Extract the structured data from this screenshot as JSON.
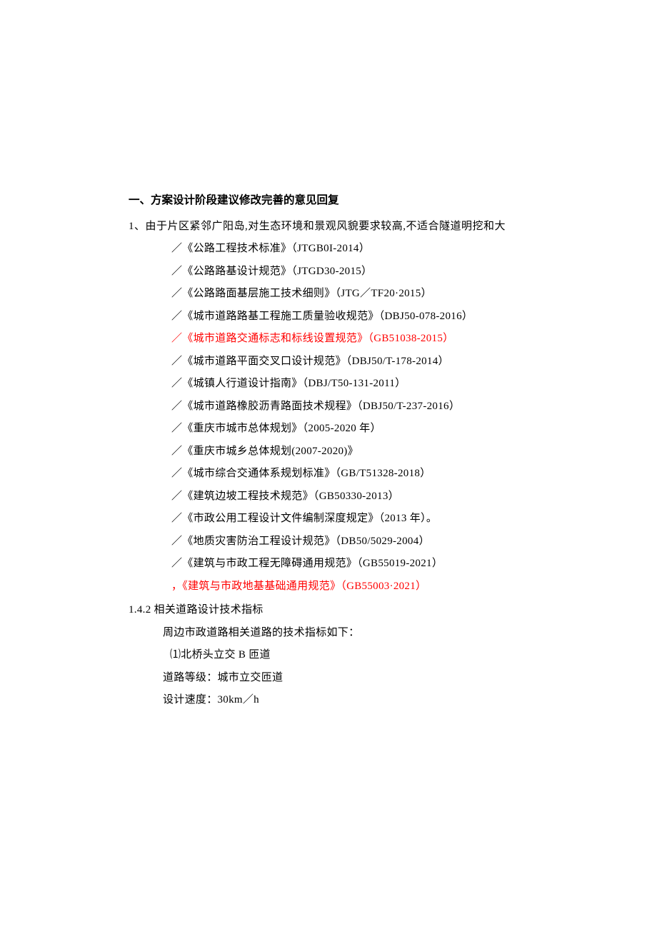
{
  "heading": "一、方案设计阶段建议修改完善的意见回复",
  "intro": "1、由于片区紧邻广阳岛,对生态环境和景观风貌要求较高,不适合隧道明挖和大",
  "standards": [
    {
      "text": "／《公路工程技术标准》（JTGB0I-2014）",
      "red": false
    },
    {
      "text": "／《公路路基设计规范》（JTGD30-2015）",
      "red": false
    },
    {
      "text": "／《公路路面基层施工技术细则》（JTG／TF20·2015）",
      "red": false
    },
    {
      "text": "／《城市道路路基工程施工质量验收规范》（DBJ50-078-2016）",
      "red": false
    },
    {
      "text": "／《城市道路交通标志和标线设置规范》（GB51038-2015）",
      "red": true
    },
    {
      "text": "／《城市道路平面交叉口设计规范》（DBJ50/T-178-2014）",
      "red": false
    },
    {
      "text": "／《城镇人行道设计指南》（DBJ/T50-131-2011）",
      "red": false
    },
    {
      "text": "／《城市道路橡胶沥青路面技术规程》（DBJ50/T-237-2016）",
      "red": false
    },
    {
      "text": "／《重庆市城市总体规划》（2005-2020 年）",
      "red": false
    },
    {
      "text": "／《重庆市城乡总体规划(2007-2020)》",
      "red": false
    },
    {
      "text": "／《城市综合交通体系规划标准》（GB/T51328-2018）",
      "red": false
    },
    {
      "text": "／《建筑边坡工程技术规范》（GB50330-2013）",
      "red": false
    },
    {
      "text": "／《市政公用工程设计文件编制深度规定》（2013 年）。",
      "red": false
    },
    {
      "text": "／《地质灾害防治工程设计规范》（DB50/5029-2004）",
      "red": false
    },
    {
      "text": "／《建筑与市政工程无障碍通用规范》（GB55019-2021）",
      "red": false
    },
    {
      "text": "，《建筑与市政地基基础通用规范》（GB55003·2021）",
      "red": true
    }
  ],
  "section": {
    "number": "1.4.2 相关道路设计技术指标",
    "intro": "周边市政道路相关道路的技术指标如下：",
    "item_label": "⑴北桥头立交 B 匝道",
    "road_grade_label": "道路等级：城市立交匝道",
    "design_speed_label": "设计速度：30km／h"
  }
}
